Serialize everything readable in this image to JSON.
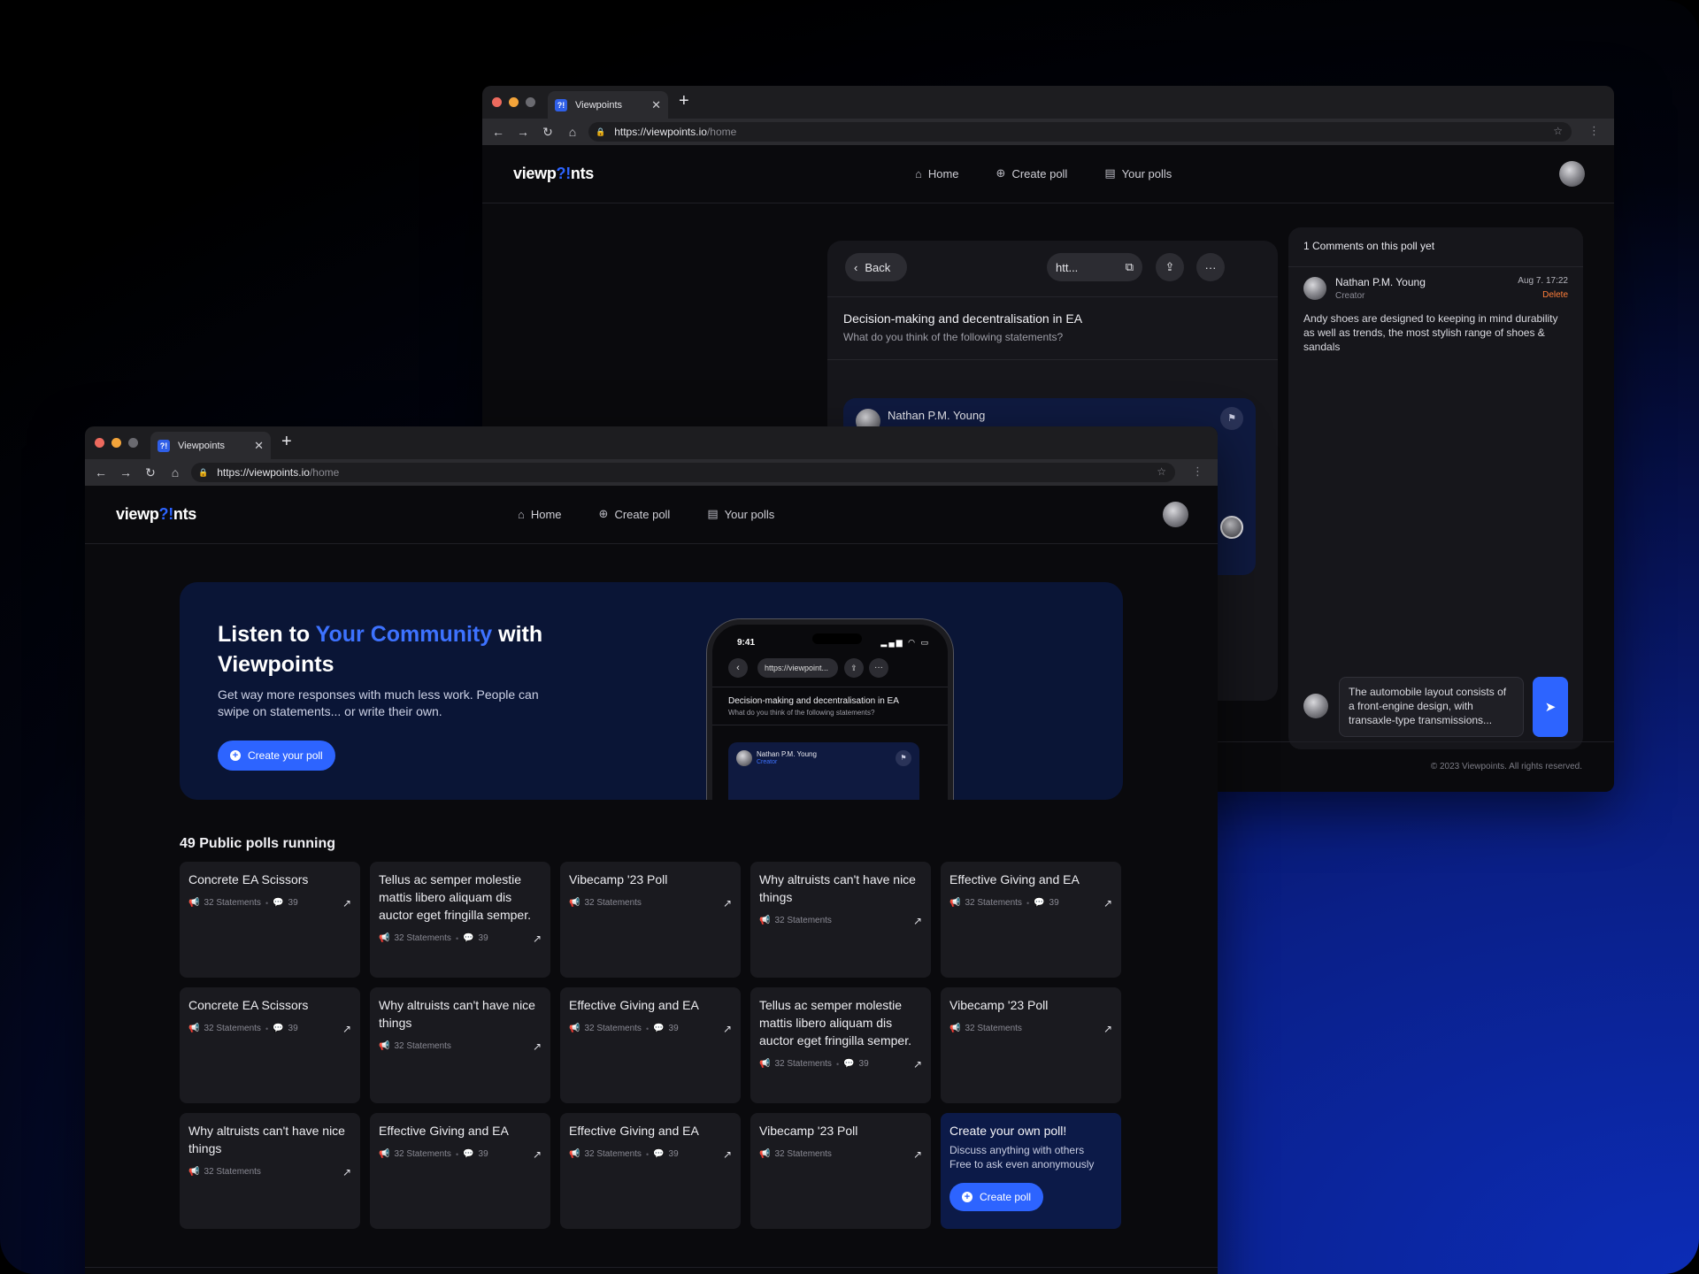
{
  "colors": {
    "accent": "#2d64ff",
    "danger": "#ff7e3a",
    "card": "#1a1a1f"
  },
  "browser": {
    "tab_title": "Viewpoints",
    "url_host": "https://viewpoints.io",
    "url_path": "/home"
  },
  "site": {
    "logo_a": "viewp",
    "logo_q": "?!",
    "logo_b": "nts",
    "nav": {
      "home": "Home",
      "create": "Create poll",
      "yours": "Your polls"
    }
  },
  "poll_view": {
    "back": "Back",
    "url_short": "htt...",
    "title": "Decision-making and decentralisation in EA",
    "subtitle": "What do you think of the following statements?",
    "statement_author": "Nathan P.M. Young"
  },
  "comments": {
    "heading": "1 Comments on this poll yet",
    "items": [
      {
        "author": "Nathan P.M. Young",
        "role": "Creator",
        "date": "Aug 7. 17:22",
        "delete": "Delete",
        "text": "Andy shoes are designed to keeping in mind durability as well as trends, the most stylish range of shoes & sandals"
      }
    ],
    "draft": "The automobile layout consists of a front-engine design, with transaxle-type transmissions..."
  },
  "footer": {
    "copyright": "© 2023 Viewpoints. All rights reserved."
  },
  "hero": {
    "title_1": "Listen to ",
    "title_accent": "Your Community",
    "title_2": " with Viewpoints",
    "subtitle": "Get way more responses with much less work. People can swipe on statements... or write their own.",
    "cta": "Create your poll"
  },
  "phone": {
    "time": "9:41",
    "status": "▂▄▆ ◠ ▭",
    "url": "https://viewpoint...",
    "title": "Decision-making and decentralisation in EA",
    "subtitle": "What do you think of the following statements?",
    "author": "Nathan P.M. Young",
    "role": "Creator"
  },
  "polls": {
    "heading": "49 Public polls running",
    "items": [
      {
        "title": "Concrete EA Scissors",
        "statements": "32 Statements",
        "comments": "39"
      },
      {
        "title": "Tellus ac semper molestie mattis libero aliquam dis auctor eget fringilla semper.",
        "statements": "32 Statements",
        "comments": "39"
      },
      {
        "title": "Vibecamp '23 Poll",
        "statements": "32 Statements",
        "comments": ""
      },
      {
        "title": "Why altruists can't have nice things",
        "statements": "32 Statements",
        "comments": ""
      },
      {
        "title": "Effective Giving and EA",
        "statements": "32 Statements",
        "comments": "39"
      },
      {
        "title": "Concrete EA Scissors",
        "statements": "32 Statements",
        "comments": "39"
      },
      {
        "title": "Why altruists can't have nice things",
        "statements": "32 Statements",
        "comments": ""
      },
      {
        "title": "Effective Giving and EA",
        "statements": "32 Statements",
        "comments": "39"
      },
      {
        "title": "Tellus ac semper molestie mattis libero aliquam dis auctor eget fringilla semper.",
        "statements": "32 Statements",
        "comments": "39"
      },
      {
        "title": "Vibecamp '23 Poll",
        "statements": "32 Statements",
        "comments": ""
      },
      {
        "title": "Why altruists can't have nice things",
        "statements": "32 Statements",
        "comments": ""
      },
      {
        "title": "Effective Giving and EA",
        "statements": "32 Statements",
        "comments": "39"
      },
      {
        "title": "Effective Giving and EA",
        "statements": "32 Statements",
        "comments": "39"
      },
      {
        "title": "Vibecamp '23 Poll",
        "statements": "32 Statements",
        "comments": ""
      }
    ],
    "cta": {
      "title": "Create your own poll!",
      "line1": "Discuss anything with others",
      "line2": "Free to ask even anonymously",
      "button": "Create poll"
    }
  }
}
